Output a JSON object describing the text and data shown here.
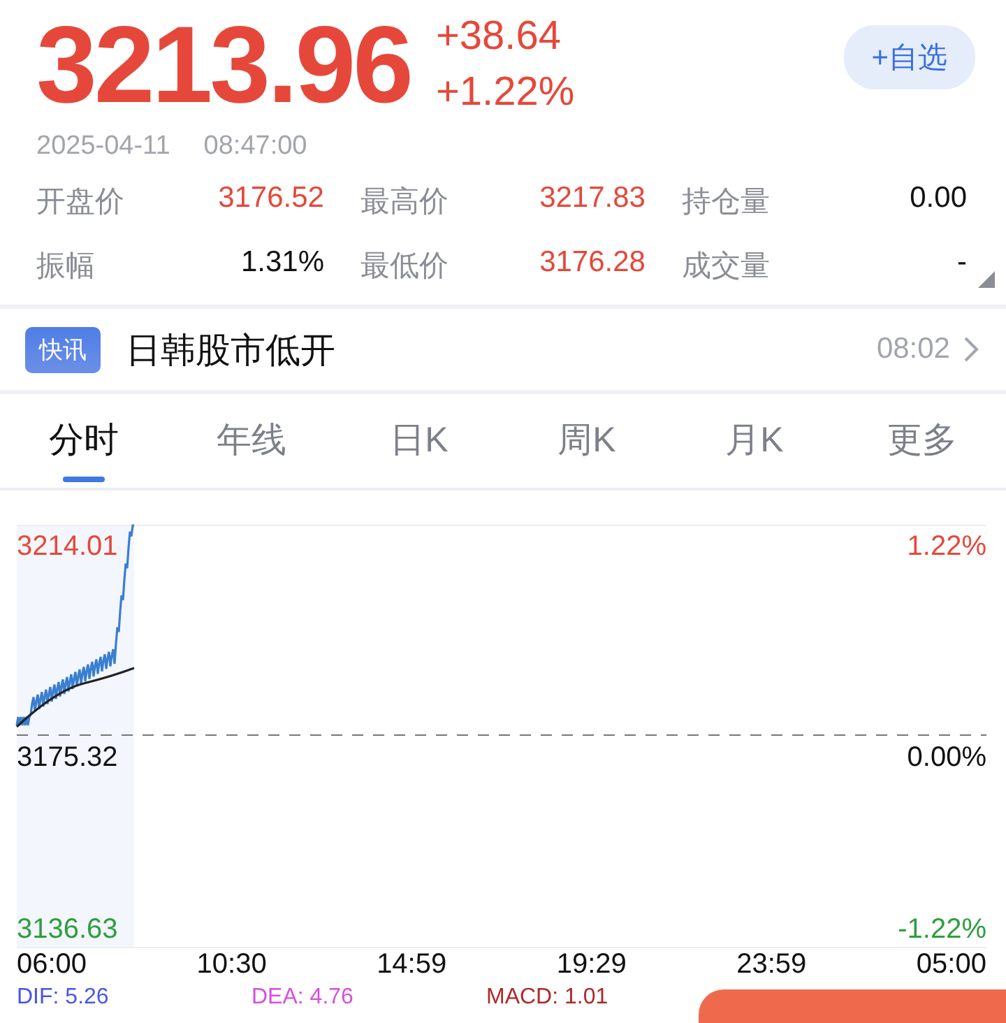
{
  "quote": {
    "price": "3213.96",
    "change": "+38.64",
    "change_pct": "+1.22%",
    "datetime": [
      "2025-04-11",
      "08:47:00"
    ],
    "watch_button": "+自选"
  },
  "stats": [
    {
      "label": "开盘价",
      "value": "3176.52",
      "color": "#e5483a"
    },
    {
      "label": "最高价",
      "value": "3217.83",
      "color": "#e5483a"
    },
    {
      "label": "持仓量",
      "value": "0.00",
      "color": "#111111"
    },
    {
      "label": "振幅",
      "value": "1.31%",
      "color": "#111111"
    },
    {
      "label": "最低价",
      "value": "3176.28",
      "color": "#e5483a"
    },
    {
      "label": "成交量",
      "value": "-",
      "color": "#111111"
    }
  ],
  "news": {
    "badge": "快讯",
    "headline": "日韩股市低开",
    "time": "08:02"
  },
  "tabs": [
    {
      "label": "分时",
      "selected": true
    },
    {
      "label": "年线",
      "selected": false
    },
    {
      "label": "日K",
      "selected": false
    },
    {
      "label": "周K",
      "selected": false
    },
    {
      "label": "月K",
      "selected": false
    },
    {
      "label": "更多",
      "selected": false
    }
  ],
  "chart": {
    "y_left": [
      {
        "text": "3214.01",
        "color": "#e5483a"
      },
      {
        "text": "3175.32",
        "color": "#111111"
      },
      {
        "text": "3136.63",
        "color": "#2e9e3e"
      }
    ],
    "y_right": [
      {
        "text": "1.22%",
        "color": "#e5483a"
      },
      {
        "text": "0.00%",
        "color": "#111111"
      },
      {
        "text": "-1.22%",
        "color": "#2e9e3e"
      }
    ],
    "x_labels": [
      "06:00",
      "10:30",
      "14:59",
      "19:29",
      "23:59",
      "05:00"
    ]
  },
  "indicators": [
    {
      "text": "DIF: 5.26",
      "color": "#4a55e6"
    },
    {
      "text": "DEA: 4.76",
      "color": "#d64fe0"
    },
    {
      "text": "MACD: 1.01",
      "color": "#b0282a"
    }
  ]
}
